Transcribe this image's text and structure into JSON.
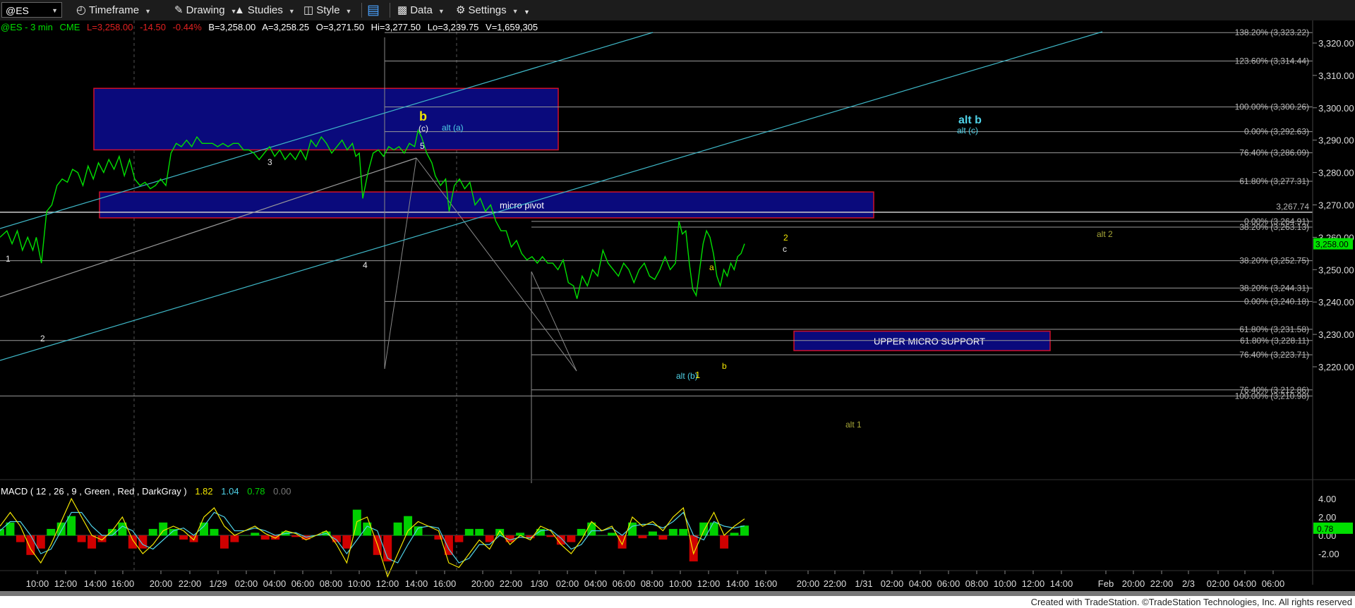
{
  "toolbar": {
    "symbol": "@ES",
    "timeframe": "Timeframe",
    "drawing": "Drawing",
    "studies": "Studies",
    "style": "Style",
    "data": "Data",
    "settings": "Settings"
  },
  "header": {
    "symbol": "@ES - 3 min",
    "exchange": "CME",
    "last": "L=3,258.00",
    "change": "-14.50",
    "change_pct": "-0.44%",
    "bid": "B=3,258.00",
    "ask": "A=3,258.25",
    "open": "O=3,271.50",
    "high": "Hi=3,277.50",
    "low": "Lo=3,239.75",
    "volume": "V=1,659,305"
  },
  "macd_header": {
    "label": "MACD ( 12 , 26 , 9 , Green , Red , DarkGray )",
    "v1": "1.82",
    "v2": "1.04",
    "v3": "0.78",
    "v4": "0.00"
  },
  "footer": "Created with TradeStation. ©TradeStation Technologies, Inc. All rights reserved",
  "colors": {
    "price": "#00e000",
    "zone_fill": "#0a0a7c",
    "zone_border": "#d0102a",
    "trendline": "#3fb8c8",
    "fib_line": "#9a9a9a",
    "wave_yellow": "#f2e600",
    "wave_cyan": "#4fd2e8",
    "olive": "#a8a838",
    "macd_pos": "#00d000",
    "macd_neg": "#d00000"
  },
  "chart_data": {
    "type": "line",
    "title": "@ES - 3 min",
    "ylim": [
      3205,
      3326
    ],
    "y_ticks": [
      "3,320.00",
      "3,310.00",
      "3,300.00",
      "3,290.00",
      "3,280.00",
      "3,270.00",
      "3,260.00",
      "3,250.00",
      "3,240.00",
      "3,230.00",
      "3,220.00"
    ],
    "x_ticks": [
      "10:00",
      "12:00",
      "14:00",
      "16:00",
      "20:00",
      "22:00",
      "1/29",
      "02:00",
      "04:00",
      "06:00",
      "08:00",
      "10:00",
      "12:00",
      "14:00",
      "16:00",
      "20:00",
      "22:00",
      "1/30",
      "02:00",
      "04:00",
      "06:00",
      "08:00",
      "10:00",
      "12:00",
      "14:00",
      "16:00",
      "20:00",
      "22:00",
      "1/31",
      "02:00",
      "04:00",
      "06:00",
      "08:00",
      "10:00",
      "12:00",
      "14:00",
      "Feb",
      "20:00",
      "22:00",
      "2/3",
      "02:00",
      "04:00",
      "06:00"
    ],
    "price_series": {
      "name": "@ES",
      "points": [
        [
          0,
          3260
        ],
        [
          8,
          3262
        ],
        [
          14,
          3258
        ],
        [
          20,
          3262
        ],
        [
          26,
          3256
        ],
        [
          32,
          3260
        ],
        [
          38,
          3256
        ],
        [
          42,
          3260
        ],
        [
          48,
          3252
        ],
        [
          54,
          3268
        ],
        [
          60,
          3270
        ],
        [
          66,
          3276
        ],
        [
          72,
          3278
        ],
        [
          78,
          3277
        ],
        [
          84,
          3281
        ],
        [
          90,
          3280
        ],
        [
          96,
          3276
        ],
        [
          102,
          3282
        ],
        [
          108,
          3278
        ],
        [
          114,
          3283
        ],
        [
          120,
          3280
        ],
        [
          126,
          3284
        ],
        [
          132,
          3281
        ],
        [
          138,
          3285
        ],
        [
          144,
          3279
        ],
        [
          150,
          3284
        ],
        [
          156,
          3278
        ],
        [
          162,
          3276
        ],
        [
          168,
          3277
        ],
        [
          174,
          3275
        ],
        [
          180,
          3276
        ],
        [
          186,
          3278
        ],
        [
          192,
          3276
        ],
        [
          198,
          3286
        ],
        [
          204,
          3289
        ],
        [
          210,
          3288
        ],
        [
          216,
          3290
        ],
        [
          222,
          3288
        ],
        [
          228,
          3291
        ],
        [
          234,
          3289
        ],
        [
          240,
          3289
        ],
        [
          246,
          3289
        ],
        [
          252,
          3288
        ],
        [
          258,
          3289
        ],
        [
          264,
          3288
        ],
        [
          270,
          3289
        ],
        [
          276,
          3289
        ],
        [
          282,
          3287
        ],
        [
          288,
          3287
        ],
        [
          294,
          3286
        ],
        [
          300,
          3284
        ],
        [
          306,
          3286
        ],
        [
          312,
          3288
        ],
        [
          318,
          3285
        ],
        [
          324,
          3287
        ],
        [
          330,
          3284
        ],
        [
          336,
          3286
        ],
        [
          342,
          3284
        ],
        [
          348,
          3287
        ],
        [
          354,
          3284
        ],
        [
          360,
          3290
        ],
        [
          366,
          3288
        ],
        [
          372,
          3291
        ],
        [
          378,
          3289
        ],
        [
          384,
          3286
        ],
        [
          390,
          3288
        ],
        [
          396,
          3290
        ],
        [
          402,
          3287
        ],
        [
          408,
          3289
        ],
        [
          412,
          3285
        ],
        [
          416,
          3286
        ],
        [
          420,
          3272
        ],
        [
          426,
          3280
        ],
        [
          432,
          3286
        ],
        [
          438,
          3287
        ],
        [
          444,
          3285
        ],
        [
          450,
          3288
        ],
        [
          456,
          3287
        ],
        [
          462,
          3288
        ],
        [
          468,
          3286
        ],
        [
          474,
          3289
        ],
        [
          480,
          3288
        ],
        [
          484,
          3293
        ],
        [
          488,
          3291
        ],
        [
          494,
          3286
        ],
        [
          500,
          3283
        ],
        [
          504,
          3279
        ],
        [
          510,
          3276
        ],
        [
          516,
          3278
        ],
        [
          520,
          3268
        ],
        [
          526,
          3276
        ],
        [
          532,
          3278
        ],
        [
          538,
          3275
        ],
        [
          544,
          3277
        ],
        [
          550,
          3270
        ],
        [
          556,
          3272
        ],
        [
          562,
          3268
        ],
        [
          568,
          3270
        ],
        [
          574,
          3265
        ],
        [
          580,
          3262
        ],
        [
          586,
          3262
        ],
        [
          592,
          3257
        ],
        [
          598,
          3259
        ],
        [
          604,
          3255
        ],
        [
          610,
          3253
        ],
        [
          616,
          3254
        ],
        [
          622,
          3252
        ],
        [
          628,
          3254
        ],
        [
          634,
          3252
        ],
        [
          640,
          3252
        ],
        [
          646,
          3250
        ],
        [
          652,
          3253
        ],
        [
          658,
          3246
        ],
        [
          664,
          3245
        ],
        [
          668,
          3241
        ],
        [
          674,
          3248
        ],
        [
          680,
          3245
        ],
        [
          686,
          3250
        ],
        [
          692,
          3248
        ],
        [
          698,
          3256
        ],
        [
          704,
          3252
        ],
        [
          710,
          3250
        ],
        [
          716,
          3248
        ],
        [
          722,
          3252
        ],
        [
          728,
          3250
        ],
        [
          734,
          3246
        ],
        [
          740,
          3250
        ],
        [
          746,
          3252
        ],
        [
          752,
          3248
        ],
        [
          758,
          3247
        ],
        [
          764,
          3250
        ],
        [
          770,
          3254
        ],
        [
          776,
          3250
        ],
        [
          782,
          3252
        ],
        [
          786,
          3265
        ],
        [
          790,
          3261
        ],
        [
          794,
          3262
        ],
        [
          798,
          3252
        ],
        [
          802,
          3244
        ],
        [
          806,
          3242
        ],
        [
          810,
          3250
        ],
        [
          814,
          3258
        ],
        [
          818,
          3262
        ],
        [
          822,
          3260
        ],
        [
          826,
          3255
        ],
        [
          830,
          3248
        ],
        [
          834,
          3245
        ],
        [
          838,
          3250
        ],
        [
          842,
          3248
        ],
        [
          846,
          3252
        ],
        [
          850,
          3250
        ],
        [
          854,
          3254
        ],
        [
          858,
          3255
        ],
        [
          862,
          3258
        ]
      ]
    },
    "horizontal_levels": [
      {
        "label": "138.20% (3,323.22)",
        "value": 3323.22
      },
      {
        "label": "123.60% (3,314.44)",
        "value": 3314.44
      },
      {
        "label": "100.00% (3,300.26)",
        "value": 3300.26
      },
      {
        "label": "0.00% (3,292.63)",
        "value": 3292.63
      },
      {
        "label": "76.40% (3,286.09)",
        "value": 3286.09
      },
      {
        "label": "61.80% (3,277.31)",
        "value": 3277.31
      },
      {
        "label": "3,267.74",
        "value": 3267.74
      },
      {
        "label": "0.00% (3,264.91)",
        "value": 3264.91
      },
      {
        "label": "38.20% (3,263.13)",
        "value": 3263.13
      },
      {
        "label": "38.20% (3,252.75)",
        "value": 3252.75
      },
      {
        "label": "38.20% (3,244.31)",
        "value": 3244.31
      },
      {
        "label": "0.00% (3,240.18)",
        "value": 3240.18
      },
      {
        "label": "61.80% (3,231.58)",
        "value": 3231.58
      },
      {
        "label": "61.80% (3,228.11)",
        "value": 3228.11
      },
      {
        "label": "76.40% (3,223.71)",
        "value": 3223.71
      },
      {
        "label": "76.40% (3,212.86)",
        "value": 3212.86
      },
      {
        "label": "100.00% (3,210.98)",
        "value": 3210.98
      }
    ],
    "last_price_tag": "3,258.00",
    "zones": [
      {
        "label": "",
        "top": 3306,
        "bottom": 3287
      },
      {
        "label": "micro pivot",
        "top": 3274,
        "bottom": 3266
      },
      {
        "label": "UPPER MICRO SUPPORT",
        "top": 3231,
        "bottom": 3225
      }
    ],
    "wave_labels": [
      {
        "text": "1",
        "color": "white"
      },
      {
        "text": "2",
        "color": "white"
      },
      {
        "text": "3",
        "color": "white"
      },
      {
        "text": "4",
        "color": "white"
      },
      {
        "text": "5",
        "color": "white"
      },
      {
        "text": "b",
        "color": "yellow"
      },
      {
        "text": "(c)",
        "color": "white"
      },
      {
        "text": "alt (a)",
        "color": "cyan"
      },
      {
        "text": "2",
        "color": "yellow"
      },
      {
        "text": "c",
        "color": "white"
      },
      {
        "text": "a",
        "color": "yellow"
      },
      {
        "text": "alt (b)",
        "color": "cyan"
      },
      {
        "text": "1",
        "color": "yellow"
      },
      {
        "text": "b",
        "color": "yellow"
      },
      {
        "text": "alt b",
        "color": "cyan"
      },
      {
        "text": "alt (c)",
        "color": "cyan"
      },
      {
        "text": "alt 2",
        "color": "olive"
      },
      {
        "text": "alt 1",
        "color": "olive"
      }
    ],
    "macd": {
      "y_ticks": [
        "4.00",
        "2.00",
        "0.00",
        "-2.00"
      ],
      "ylim": [
        -5,
        5.5
      ],
      "last_value_tag": "0.78",
      "fast": [
        1,
        2.5,
        1,
        -1.5,
        -3,
        -1,
        1.5,
        4,
        2,
        0,
        -0.5,
        0.5,
        2,
        -0.5,
        -2,
        -1,
        0.5,
        1,
        0.5,
        -0.5,
        2,
        3,
        1,
        0,
        0.5,
        1,
        0.2,
        -0.3,
        0.5,
        0.2,
        -0.5,
        0,
        0.5,
        -1,
        -3,
        1.5,
        2,
        -1,
        -4.5,
        -2,
        0.5,
        1.5,
        1,
        0.5,
        -3,
        -3.5,
        -2,
        -0.5,
        -1.5,
        0.5,
        -1,
        0,
        -0.5,
        1,
        0.5,
        -1,
        -2,
        -0.5,
        1.5,
        0.5,
        1,
        -1,
        2,
        1,
        1.5,
        0.5,
        2,
        3,
        -2,
        0.5,
        2.5,
        0,
        1,
        1.8
      ],
      "slow": [
        0.5,
        1.5,
        1.5,
        0,
        -2,
        -1.5,
        0.5,
        2.5,
        2.5,
        1,
        0,
        0,
        1,
        0.5,
        -1,
        -1.5,
        -0.5,
        0.5,
        0.8,
        0,
        1,
        2.5,
        2,
        0.5,
        0.5,
        0.8,
        0.5,
        0,
        0.2,
        0.3,
        -0.2,
        0,
        0.2,
        -0.5,
        -2,
        -0.5,
        1,
        0.5,
        -2.5,
        -3,
        -1,
        0.8,
        1,
        0.8,
        -1.5,
        -3,
        -2.5,
        -1,
        -1,
        0,
        -0.5,
        -0.2,
        -0.3,
        0.5,
        0.6,
        -0.3,
        -1.5,
        -1,
        0.5,
        0.5,
        0.8,
        0,
        1,
        1.2,
        1.2,
        0.8,
        1.5,
        2.5,
        0,
        -0.5,
        1.5,
        1,
        0.8,
        1.04
      ]
    }
  }
}
